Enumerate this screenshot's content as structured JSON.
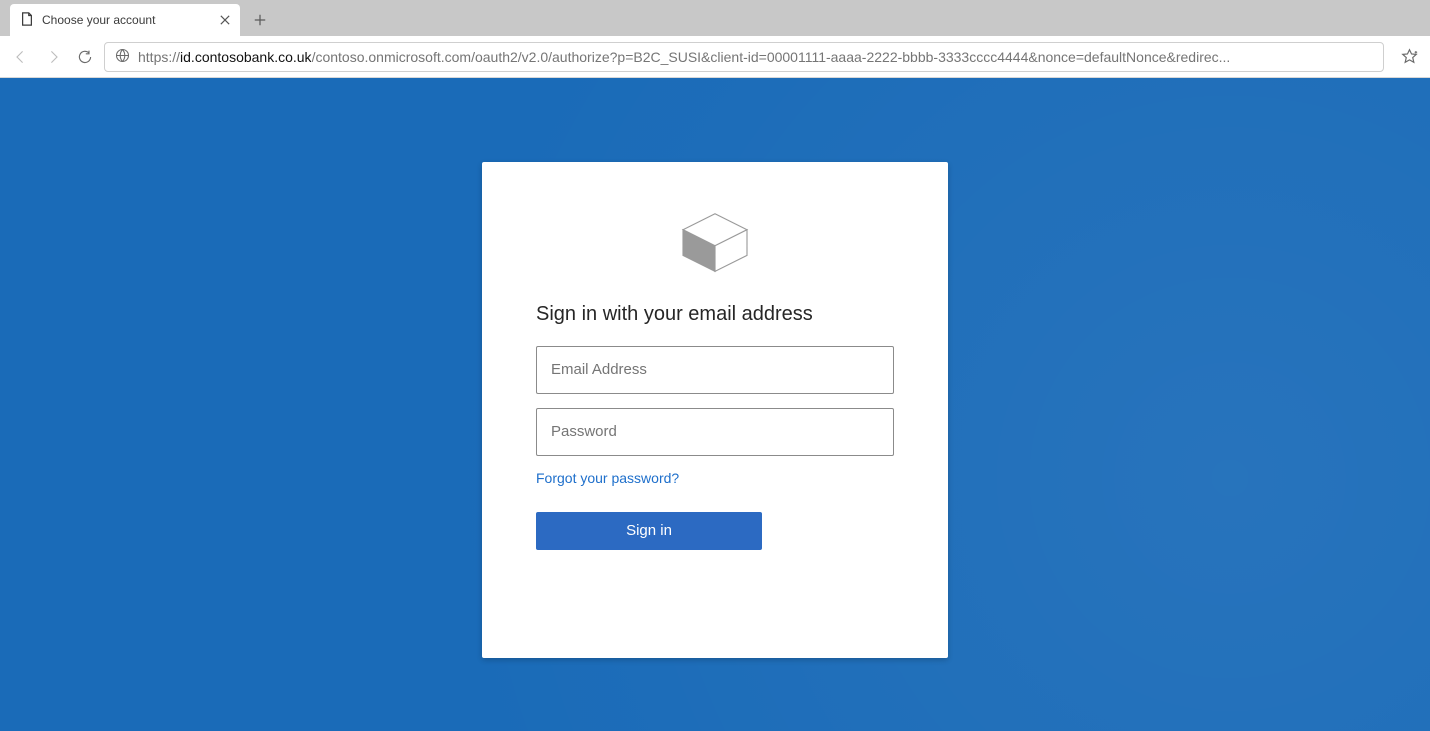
{
  "browser": {
    "tab_title": "Choose your account",
    "url_protocol": "https://",
    "url_host": "id.contosobank.co.uk",
    "url_rest": "/contoso.onmicrosoft.com/oauth2/v2.0/authorize?p=B2C_SUSI&client-id=00001111-aaaa-2222-bbbb-3333cccc4444&nonce=defaultNonce&redirec..."
  },
  "signin": {
    "heading": "Sign in with your email address",
    "email_placeholder": "Email Address",
    "password_placeholder": "Password",
    "forgot_label": "Forgot your password?",
    "submit_label": "Sign in"
  },
  "colors": {
    "page_bg": "#1a6bb8",
    "primary_button": "#2c6ac2",
    "link": "#1e6fcb"
  }
}
